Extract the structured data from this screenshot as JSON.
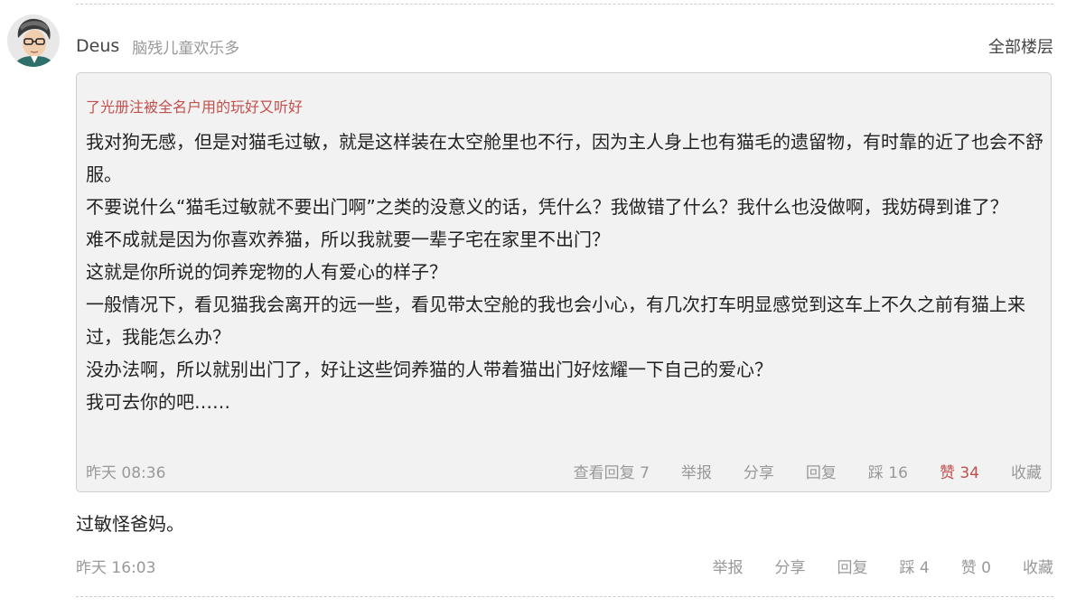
{
  "comment": {
    "author": "Deus",
    "signature": "脑残儿童欢乐多",
    "all_floors": "全部楼层",
    "quote": {
      "user": "了光册注被全名户用的玩好又听好",
      "paragraphs": [
        "我对狗无感，但是对猫毛过敏，就是这样装在太空舱里也不行，因为主人身上也有猫毛的遗留物，有时靠的近了也会不舒服。",
        "不要说什么“猫毛过敏就不要出门啊”之类的没意义的话，凭什么？我做错了什么？我什么也没做啊，我妨碍到谁了？",
        "难不成就是因为你喜欢养猫，所以我就要一辈子宅在家里不出门？",
        "这就是你所说的饲养宠物的人有爱心的样子？",
        "一般情况下，看见猫我会离开的远一些，看见带太空舱的我也会小心，有几次打车明显感觉到这车上不久之前有猫上来过，我能怎么办？",
        "没办法啊，所以就别出门了，好让这些饲养猫的人带着猫出门好炫耀一下自己的爱心？",
        "我可去你的吧……"
      ],
      "time": "昨天 08:36",
      "actions": {
        "view_replies": "查看回复 7",
        "report": "举报",
        "share": "分享",
        "reply": "回复",
        "dislike": "踩 16",
        "like": "赞 34",
        "favorite": "收藏"
      }
    },
    "text": "过敏怪爸妈。",
    "time": "昨天 16:03",
    "actions": {
      "report": "举报",
      "share": "分享",
      "reply": "回复",
      "dislike": "踩 4",
      "like": "赞 0",
      "favorite": "收藏"
    }
  },
  "colors": {
    "accent_red": "#c0504d",
    "muted": "#999999",
    "quote_bg": "#f2f2f2"
  }
}
